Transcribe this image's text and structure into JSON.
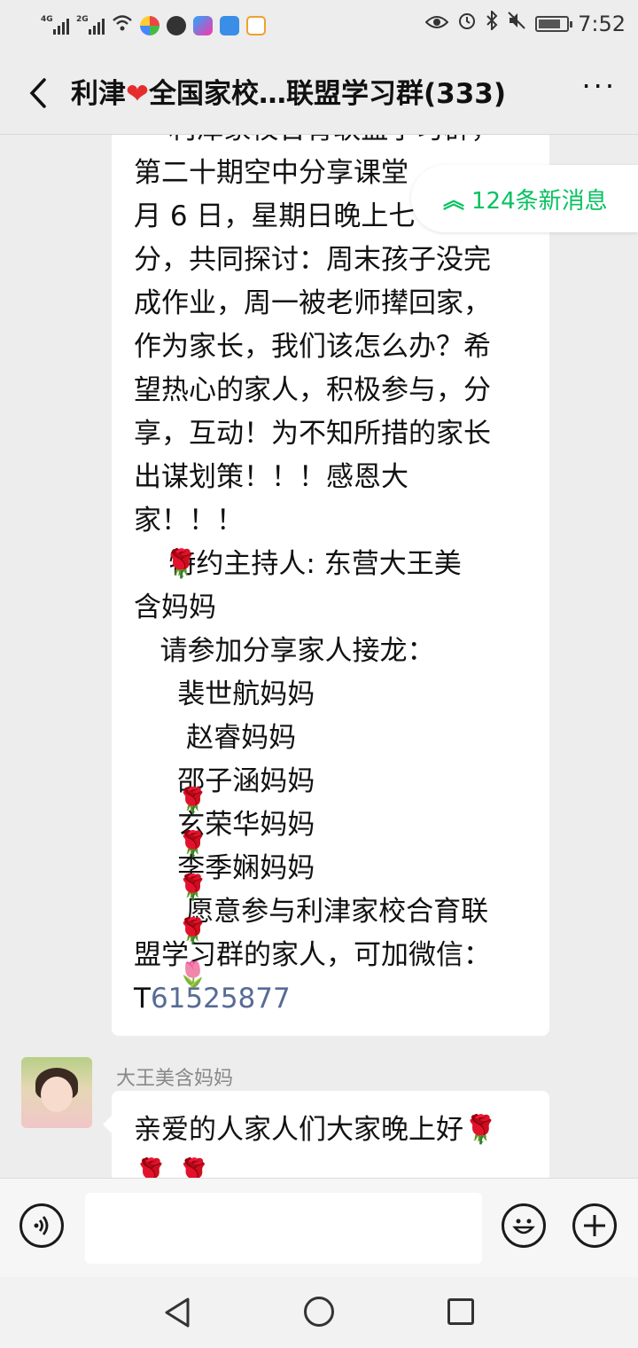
{
  "status_bar": {
    "network_1": "4G",
    "network_2": "2G",
    "time": "7:52"
  },
  "header": {
    "title_prefix": "利津",
    "title_suffix": "全国家校…联盟学习群(333)",
    "heart_icon": "heart-icon",
    "more_label": "···"
  },
  "new_messages": {
    "label": "124条新消息"
  },
  "message1": {
    "lines": [
      "    利津家校合育联盟学习群，",
      "第二十期空中分享课堂",
      "月 6 日，星期日晚上七",
      "分，共同探讨：周末孩子没完",
      "成作业，周一被老师撵回家，",
      "作为家长，我们该怎么办？希",
      "望热心的家人，积极参与，分",
      "享，互动！为不知所措的家长",
      "出谋划策！！！感恩大",
      "家！！！",
      "    特约主持人: 东营大王美",
      "含妈妈",
      "   请参加分享家人接龙：",
      "     裴世航妈妈",
      "      赵睿妈妈",
      "     邵子涵妈妈",
      "     玄荣华妈妈",
      "     李季娴妈妈",
      "      愿意参与利津家校合育联",
      "盟学习群的家人，可加微信："
    ],
    "wechat_prefix": "T",
    "wechat_number": "61525877"
  },
  "message2": {
    "sender": "大王美含妈妈",
    "text": "亲爱的人家人们大家晚上好"
  },
  "nav": {
    "back_icon": "triangle-back-icon",
    "home_icon": "circle-home-icon",
    "recent_icon": "square-recent-icon"
  }
}
